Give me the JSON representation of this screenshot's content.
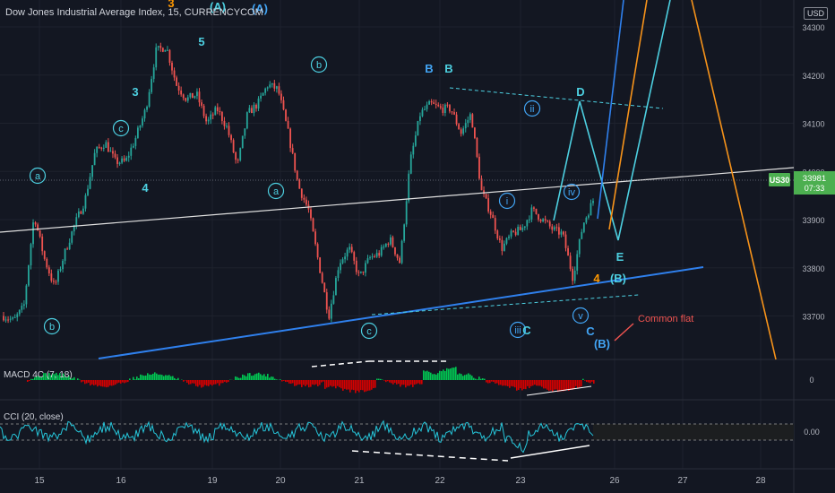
{
  "header": {
    "title": "Dow Jones Industrial Average Index, 15, CURRENCYCOM"
  },
  "currency_button": "USD",
  "price_tag": {
    "symbol": "US30",
    "price": "33981",
    "countdown": "07:33"
  },
  "indicators": {
    "macd": "MACD 4C (7, 18)",
    "cci": "CCI (20, close)"
  },
  "colors": {
    "background": "#131722",
    "wave_label": "#4dd0e1",
    "blue_label": "#42a5f5",
    "orange_label": "#ff9800",
    "blue_line": "#2f80ed",
    "orange_line": "#f7931a",
    "cyan_line": "#4dd0e1",
    "up_candle": "#26a69a",
    "down_candle": "#ef5350",
    "macd_up": "#00c853",
    "macd_down": "#d50000",
    "cci_line": "#26c6da",
    "price_tag": "#4caf50",
    "annotation_red": "#ef5350"
  },
  "chart_data": [
    {
      "type": "line",
      "pane": "price",
      "title": "Dow Jones Industrial Average Index, 15, CURRENCYCOM",
      "ylim": [
        33610,
        34320
      ],
      "x_ticks": [
        "15",
        "16",
        "19",
        "20",
        "21",
        "22",
        "23",
        "26",
        "27",
        "28"
      ],
      "y_ticks": [
        33700,
        33800,
        33900,
        34000,
        34100,
        34200,
        34300
      ],
      "last_price": 33981,
      "series": [
        {
          "values": [
            33700,
            33690,
            33720,
            33910,
            33820,
            33760,
            33830,
            33890,
            33940,
            34040,
            34060,
            34020,
            34020,
            34070,
            34130,
            34250,
            34260,
            34180,
            34150,
            34160,
            34100,
            34130,
            34090,
            34010,
            34120,
            34140,
            34180,
            34170,
            34080,
            33970,
            33920,
            33810,
            33700,
            33810,
            33840,
            33780,
            33820,
            33830,
            33860,
            33810,
            34020,
            34120,
            34140,
            34130,
            34130,
            34080,
            34120,
            33960,
            33910,
            33840,
            33870,
            33880,
            33920,
            33900,
            33880,
            33870,
            33780,
            33890,
            33940
          ]
        }
      ],
      "wave_labels": [
        {
          "text": "a",
          "circled": true,
          "color": "cyan"
        },
        {
          "text": "b",
          "circled": true,
          "color": "cyan"
        },
        {
          "text": "c",
          "circled": true,
          "color": "cyan"
        },
        {
          "text": "3",
          "circled": false,
          "color": "cyan"
        },
        {
          "text": "4",
          "circled": false,
          "color": "cyan"
        },
        {
          "text": "5",
          "circled": false,
          "color": "cyan"
        },
        {
          "text": "3",
          "circled": false,
          "color": "orange"
        },
        {
          "text": "(A)",
          "circled": false,
          "color": "cyan"
        },
        {
          "text": "(A)",
          "circled": false,
          "color": "blue"
        },
        {
          "text": "b",
          "circled": true,
          "color": "cyan"
        },
        {
          "text": "a",
          "circled": true,
          "color": "cyan"
        },
        {
          "text": "c",
          "circled": true,
          "color": "cyan"
        },
        {
          "text": "B",
          "circled": false,
          "color": "blue"
        },
        {
          "text": "B",
          "circled": false,
          "color": "cyan"
        },
        {
          "text": "ii",
          "circled": true,
          "color": "blue"
        },
        {
          "text": "i",
          "circled": true,
          "color": "blue"
        },
        {
          "text": "iii",
          "circled": true,
          "color": "blue"
        },
        {
          "text": "C",
          "circled": false,
          "color": "cyan"
        },
        {
          "text": "iv",
          "circled": true,
          "color": "blue"
        },
        {
          "text": "v",
          "circled": true,
          "color": "blue"
        },
        {
          "text": "C",
          "circled": false,
          "color": "blue"
        },
        {
          "text": "4",
          "circled": false,
          "color": "orange"
        },
        {
          "text": "D",
          "circled": false,
          "color": "cyan"
        },
        {
          "text": "E",
          "circled": false,
          "color": "cyan"
        },
        {
          "text": "(B)",
          "circled": false,
          "color": "cyan"
        },
        {
          "text": "(B)",
          "circled": false,
          "color": "blue"
        }
      ],
      "annotations": [
        "Common flat"
      ]
    },
    {
      "type": "bar",
      "pane": "macd",
      "title": "MACD 4C (7, 18)",
      "y_ticks": [
        0
      ]
    },
    {
      "type": "line",
      "pane": "cci",
      "title": "CCI (20, close)",
      "y_ticks": [
        "0.00"
      ],
      "series": [
        {
          "name": "CCI (20, close)"
        }
      ]
    }
  ]
}
